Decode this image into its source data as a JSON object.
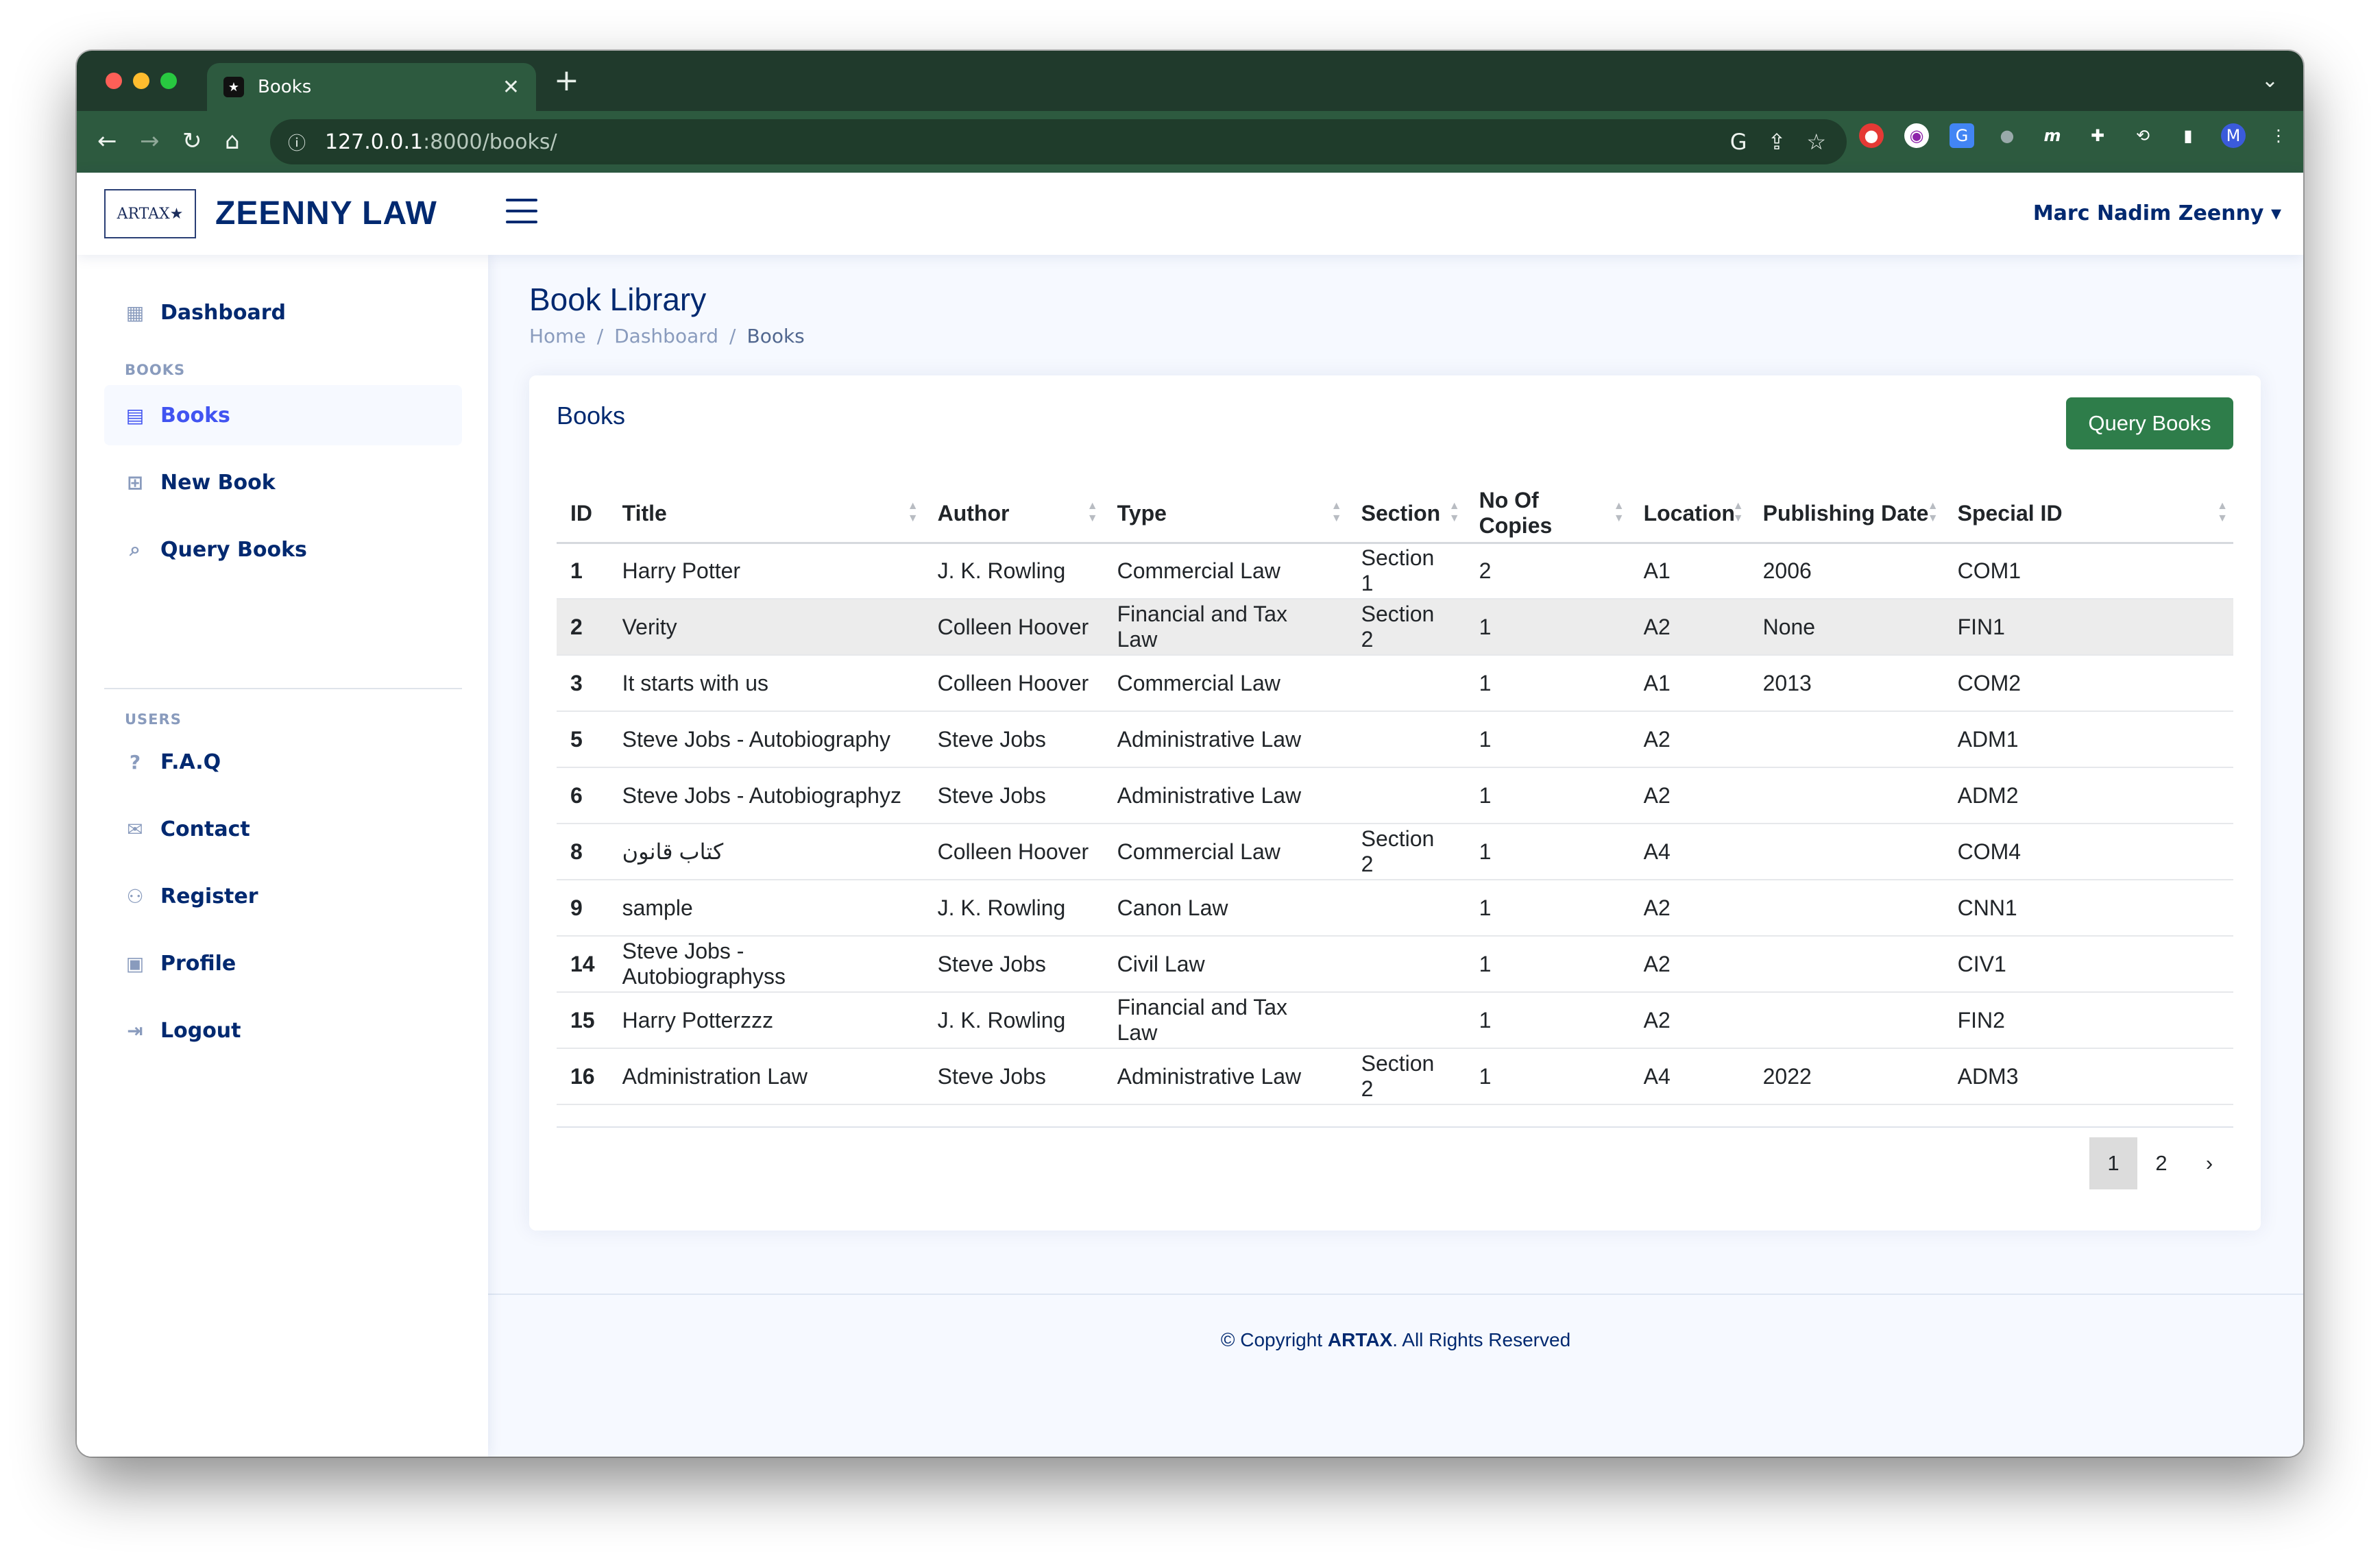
{
  "browser": {
    "tab_title": "Books",
    "url_host": "127.0.0.1",
    "url_path": ":8000/books/"
  },
  "header": {
    "logo_text": "ARTAX",
    "brand": "ZEENNY LAW",
    "user_name": "Marc Nadim Zeenny"
  },
  "sidebar": {
    "dashboard": "Dashboard",
    "books_heading": "BOOKS",
    "books": "Books",
    "new_book": "New Book",
    "query_books": "Query Books",
    "users_heading": "USERS",
    "faq": "F.A.Q",
    "contact": "Contact",
    "register": "Register",
    "profile": "Profile",
    "logout": "Logout"
  },
  "page": {
    "title": "Book Library",
    "breadcrumb": [
      "Home",
      "Dashboard",
      "Books"
    ],
    "card_title": "Books",
    "query_button": "Query Books"
  },
  "table": {
    "headers": [
      "ID",
      "Title",
      "Author",
      "Type",
      "Section",
      "No Of Copies",
      "Location",
      "Publishing Date",
      "Special ID"
    ],
    "rows": [
      [
        "1",
        "Harry Potter",
        "J. K. Rowling",
        "Commercial Law",
        "Section 1",
        "2",
        "A1",
        "2006",
        "COM1"
      ],
      [
        "2",
        "Verity",
        "Colleen Hoover",
        "Financial and Tax Law",
        "Section 2",
        "1",
        "A2",
        "None",
        "FIN1"
      ],
      [
        "3",
        "It starts with us",
        "Colleen Hoover",
        "Commercial Law",
        "",
        "1",
        "A1",
        "2013",
        "COM2"
      ],
      [
        "5",
        "Steve Jobs - Autobiography",
        "Steve Jobs",
        "Administrative Law",
        "",
        "1",
        "A2",
        "",
        "ADM1"
      ],
      [
        "6",
        "Steve Jobs - Autobiographyz",
        "Steve Jobs",
        "Administrative Law",
        "",
        "1",
        "A2",
        "",
        "ADM2"
      ],
      [
        "8",
        "كتاب قانون",
        "Colleen Hoover",
        "Commercial Law",
        "Section 2",
        "1",
        "A4",
        "",
        "COM4"
      ],
      [
        "9",
        "sample",
        "J. K. Rowling",
        "Canon Law",
        "",
        "1",
        "A2",
        "",
        "CNN1"
      ],
      [
        "14",
        "Steve Jobs - Autobiographyss",
        "Steve Jobs",
        "Civil Law",
        "",
        "1",
        "A2",
        "",
        "CIV1"
      ],
      [
        "15",
        "Harry Potterzzz",
        "J. K. Rowling",
        "Financial and Tax Law",
        "",
        "1",
        "A2",
        "",
        "FIN2"
      ],
      [
        "16",
        "Administration Law",
        "Steve Jobs",
        "Administrative Law",
        "Section 2",
        "1",
        "A4",
        "2022",
        "ADM3"
      ]
    ]
  },
  "pagination": {
    "pages": [
      "1",
      "2"
    ],
    "next": "›",
    "current": "1"
  },
  "footer": {
    "prefix": "© Copyright ",
    "brand": "ARTAX",
    "suffix": ". All Rights Reserved"
  },
  "colors": {
    "brand_navy": "#012970",
    "accent_blue": "#4154f1",
    "button_green": "#2e7d4a",
    "browser_chrome": "#2d5a3f"
  }
}
